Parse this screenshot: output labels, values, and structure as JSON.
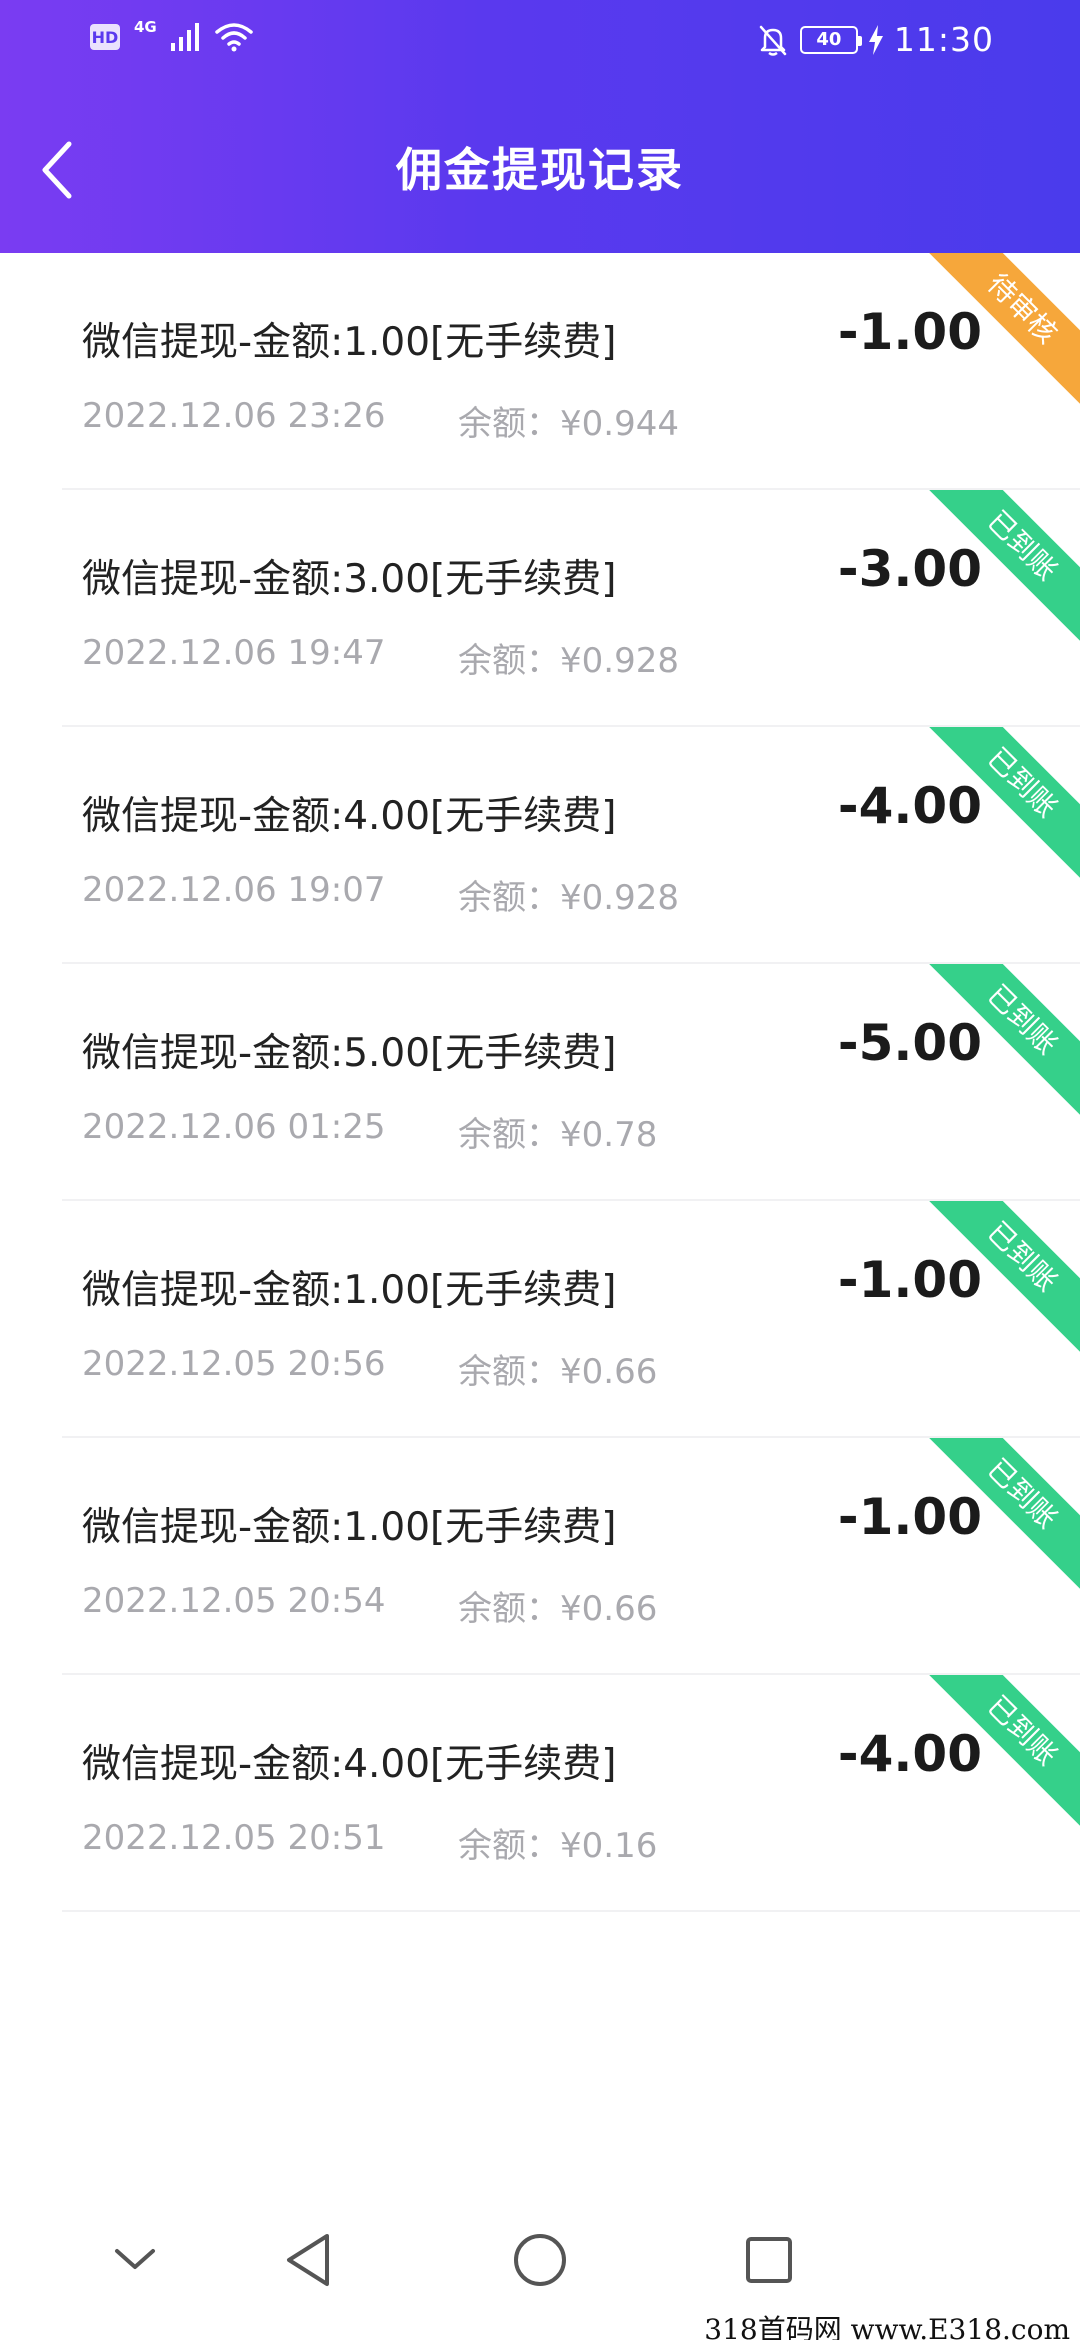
{
  "status_bar": {
    "hd_label": "HD",
    "network_type": "4G",
    "battery_level": "40",
    "time": "11:30",
    "icons": [
      "hd-icon",
      "signal-icon",
      "wifi-icon",
      "bell-off-icon",
      "battery-icon",
      "charging-icon"
    ]
  },
  "header": {
    "title": "佣金提现记录",
    "back_icon": "chevron-left-icon"
  },
  "colors": {
    "header_gradient_start": "#7a3cf2",
    "header_gradient_end": "#4a3bec",
    "pending_ribbon": "#f6a73b",
    "arrived_ribbon": "#35d08a",
    "amount_text": "#1b1b1b",
    "secondary_text": "#a9a9ae"
  },
  "records": [
    {
      "title": "微信提现-金额:1.00[无手续费]",
      "time": "2022.12.06 23:26",
      "balance": "余额：¥0.944",
      "amount": "-1.00",
      "status": "待审核",
      "status_color": "#f6a73b"
    },
    {
      "title": "微信提现-金额:3.00[无手续费]",
      "time": "2022.12.06 19:47",
      "balance": "余额：¥0.928",
      "amount": "-3.00",
      "status": "已到账",
      "status_color": "#35d08a"
    },
    {
      "title": "微信提现-金额:4.00[无手续费]",
      "time": "2022.12.06 19:07",
      "balance": "余额：¥0.928",
      "amount": "-4.00",
      "status": "已到账",
      "status_color": "#35d08a"
    },
    {
      "title": "微信提现-金额:5.00[无手续费]",
      "time": "2022.12.06 01:25",
      "balance": "余额：¥0.78",
      "amount": "-5.00",
      "status": "已到账",
      "status_color": "#35d08a"
    },
    {
      "title": "微信提现-金额:1.00[无手续费]",
      "time": "2022.12.05 20:56",
      "balance": "余额：¥0.66",
      "amount": "-1.00",
      "status": "已到账",
      "status_color": "#35d08a"
    },
    {
      "title": "微信提现-金额:1.00[无手续费]",
      "time": "2022.12.05 20:54",
      "balance": "余额：¥0.66",
      "amount": "-1.00",
      "status": "已到账",
      "status_color": "#35d08a"
    },
    {
      "title": "微信提现-金额:4.00[无手续费]",
      "time": "2022.12.05 20:51",
      "balance": "余额：¥0.16",
      "amount": "-4.00",
      "status": "已到账",
      "status_color": "#35d08a"
    }
  ],
  "nav_bar": {
    "icons": [
      "chevron-down-icon",
      "back-triangle-icon",
      "home-circle-icon",
      "recents-square-icon"
    ]
  },
  "watermark": "318首码网 www.E318.com"
}
